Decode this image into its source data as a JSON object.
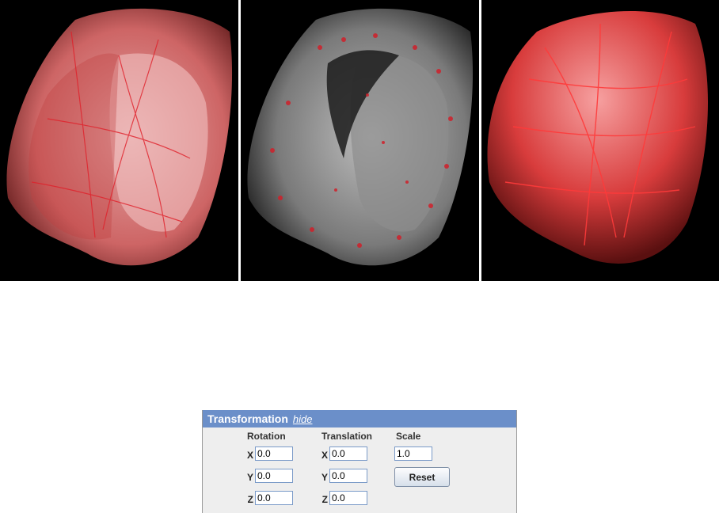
{
  "viewer": {
    "panels": [
      {
        "name": "render-left",
        "description_icon": "heart-volume-render"
      },
      {
        "name": "render-middle",
        "description_icon": "heart-volume-render"
      },
      {
        "name": "render-right",
        "description_icon": "heart-volume-render"
      }
    ],
    "colors": {
      "background": "#000000",
      "tissue": "#d9d9d9",
      "vessels": "#e0202a"
    }
  },
  "transformation": {
    "title": "Transformation",
    "hide_label": "hide",
    "header_color": "#6b8fc9",
    "rotation": {
      "label": "Rotation",
      "x_label": "X",
      "y_label": "Y",
      "z_label": "Z",
      "x": "0.0",
      "y": "0.0",
      "z": "0.0"
    },
    "translation": {
      "label": "Translation",
      "x_label": "X",
      "y_label": "Y",
      "z_label": "Z",
      "x": "0.0",
      "y": "0.0",
      "z": "0.0"
    },
    "scale": {
      "label": "Scale",
      "value": "1.0"
    },
    "reset_label": "Reset"
  }
}
